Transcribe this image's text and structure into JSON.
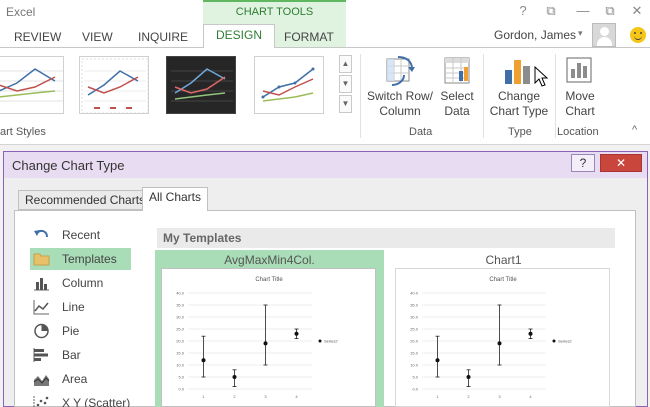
{
  "app": {
    "title": "Excel",
    "context_header": "CHART TOOLS",
    "window_controls": {
      "help": "?",
      "restore": "⧉",
      "minimize": "—",
      "close": "✕"
    }
  },
  "ribbon_tabs": [
    {
      "label": "REVIEW",
      "active": false
    },
    {
      "label": "VIEW",
      "active": false
    },
    {
      "label": "INQUIRE",
      "active": false
    },
    {
      "label": "DESIGN",
      "active": true
    },
    {
      "label": "FORMAT",
      "active": false
    }
  ],
  "user": {
    "name": "Gordon, James",
    "caret": "▾"
  },
  "ribbon": {
    "chart_styles_label": "art Styles",
    "gallery_scroll": {
      "up": "▲",
      "down": "▼",
      "more": "▼"
    },
    "switch_row_column": "Switch Row/ Column",
    "select_data": "Select Data",
    "data_group_label": "Data",
    "change_chart_type": "Change Chart Type",
    "type_group_label": "Type",
    "move_chart": "Move Chart",
    "location_group_label": "Location",
    "collapse_caret": "^",
    "colors": {
      "green_accent": "#2e7d32",
      "bar_blue": "#3f6ea8",
      "bar_orange": "#f0a030",
      "bar_gray": "#8c8c8c"
    }
  },
  "dialog": {
    "title": "Change Chart Type",
    "help_label": "?",
    "close_label": "✕",
    "tabs": [
      {
        "label": "Recommended Charts",
        "active": false
      },
      {
        "label": "All Charts",
        "active": true
      }
    ],
    "chart_types": [
      {
        "label": "Recent",
        "icon": "undo-arrow-icon",
        "selected": false
      },
      {
        "label": "Templates",
        "icon": "folder-icon",
        "selected": true
      },
      {
        "label": "Column",
        "icon": "column-chart-icon",
        "selected": false
      },
      {
        "label": "Line",
        "icon": "line-chart-icon",
        "selected": false
      },
      {
        "label": "Pie",
        "icon": "pie-chart-icon",
        "selected": false
      },
      {
        "label": "Bar",
        "icon": "bar-chart-icon",
        "selected": false
      },
      {
        "label": "Area",
        "icon": "area-chart-icon",
        "selected": false
      },
      {
        "label": "X Y (Scatter)",
        "icon": "scatter-chart-icon",
        "selected": false
      }
    ],
    "section_title": "My Templates",
    "templates": [
      {
        "name": "AvgMaxMin4Col.",
        "selected": true
      },
      {
        "name": "Chart1",
        "selected": false
      }
    ],
    "preview": {
      "chart_title": "Chart Title",
      "y_ticks": [
        "40.0",
        "35.0",
        "30.0",
        "25.0",
        "20.0",
        "15.0",
        "10.0",
        "5.0",
        "0.0"
      ],
      "x_ticks": [
        "1",
        "2",
        "3",
        "4"
      ],
      "legend": "Series2"
    },
    "colors": {
      "selected_bg": "#a8ddb7",
      "title_bar": "#e8dcf2",
      "close_red": "#c9463d"
    }
  },
  "chart_data": {
    "type": "scatter",
    "title": "Chart Title",
    "x": [
      1,
      2,
      3,
      4
    ],
    "series": [
      {
        "name": "Series2",
        "values": [
          12,
          5,
          19,
          23
        ],
        "low": [
          5,
          1,
          10,
          21
        ],
        "high": [
          22,
          8,
          35,
          25
        ]
      }
    ],
    "ylim": [
      0,
      40
    ],
    "y_ticks": [
      0,
      5,
      10,
      15,
      20,
      25,
      30,
      35,
      40
    ],
    "grid": true,
    "legend": "right"
  }
}
